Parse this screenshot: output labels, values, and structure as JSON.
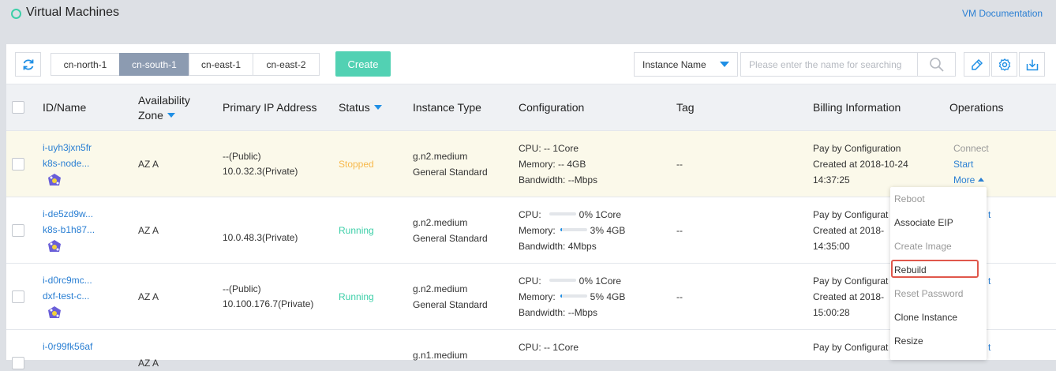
{
  "header": {
    "title": "Virtual Machines",
    "doc_link": "VM Documentation"
  },
  "toolbar": {
    "regions": [
      "cn-north-1",
      "cn-south-1",
      "cn-east-1",
      "cn-east-2"
    ],
    "active_region": "cn-south-1",
    "create_label": "Create",
    "filter_select": "Instance Name",
    "search_placeholder": "Please enter the name for searching"
  },
  "table": {
    "columns": {
      "id_name": "ID/Name",
      "zone_line1": "Availability",
      "zone_line2": "Zone",
      "ip": "Primary IP Address",
      "status": "Status",
      "type": "Instance Type",
      "config": "Configuration",
      "tag": "Tag",
      "billing": "Billing Information",
      "ops": "Operations"
    },
    "rows": [
      {
        "id": "i-uyh3jxn5fr",
        "name": "k8s-node...",
        "zone": "AZ A",
        "ip_public": "--(Public)",
        "ip_private": "10.0.32.3(Private)",
        "status": "Stopped",
        "type": "g.n2.medium",
        "family": "General Standard",
        "cpu": "CPU:  -- 1Core",
        "memory": "Memory:  -- 4GB",
        "bandwidth": "Bandwidth:  --Mbps",
        "tag": "--",
        "billing": "Pay by Configuration",
        "created": "Created at 2018-10-24",
        "time": "14:37:25",
        "op1": "Connect",
        "op2": "Start",
        "op3": "More"
      },
      {
        "id": "i-de5zd9w...",
        "name": "k8s-b1h87...",
        "zone": "AZ A",
        "ip_public": "",
        "ip_private": "10.0.48.3(Private)",
        "status": "Running",
        "type": "g.n2.medium",
        "family": "General Standard",
        "cpu_label": "CPU:",
        "cpu_pct": "0%",
        "cpu_val": "1Core",
        "cpu_fill": 0,
        "mem_label": "Memory:",
        "mem_pct": "3%",
        "mem_val": "4GB",
        "mem_fill": 3,
        "bandwidth": "Bandwidth:  4Mbps",
        "tag": "--",
        "billing": "Pay by Configurat",
        "created": "Created at 2018-",
        "time": "14:35:00",
        "op_partial": "t"
      },
      {
        "id": "i-d0rc9mc...",
        "name": "dxf-test-c...",
        "zone": "AZ A",
        "ip_public": "--(Public)",
        "ip_private": "10.100.176.7(Private)",
        "status": "Running",
        "type": "g.n2.medium",
        "family": "General Standard",
        "cpu_label": "CPU:",
        "cpu_pct": "0%",
        "cpu_val": "1Core",
        "cpu_fill": 0,
        "mem_label": "Memory:",
        "mem_pct": "5%",
        "mem_val": "4GB",
        "mem_fill": 5,
        "bandwidth": "Bandwidth:  --Mbps",
        "tag": "--",
        "billing": "Pay by Configurat",
        "created": "Created at 2018-",
        "time": "15:00:28",
        "op_partial": "t"
      },
      {
        "id": "i-0r99fk56af",
        "zone": "AZ A",
        "type": "g.n1.medium",
        "cpu": "CPU:  -- 1Core",
        "billing": "Pay by Configurat",
        "op_partial": "t"
      }
    ]
  },
  "more_menu": {
    "items": [
      {
        "label": "Reboot",
        "enabled": false
      },
      {
        "label": "Associate EIP",
        "enabled": true
      },
      {
        "label": "Create Image",
        "enabled": false
      },
      {
        "label": "Rebuild",
        "enabled": true,
        "highlighted": true
      },
      {
        "label": "Reset Password",
        "enabled": false
      },
      {
        "label": "Clone Instance",
        "enabled": true
      },
      {
        "label": "Resize",
        "enabled": true
      }
    ]
  },
  "colors": {
    "accent": "#2a7fd3",
    "create": "#52d1b3",
    "running": "#3dcfa8",
    "stopped": "#f7b84b",
    "highlight_box": "#e0574b"
  }
}
